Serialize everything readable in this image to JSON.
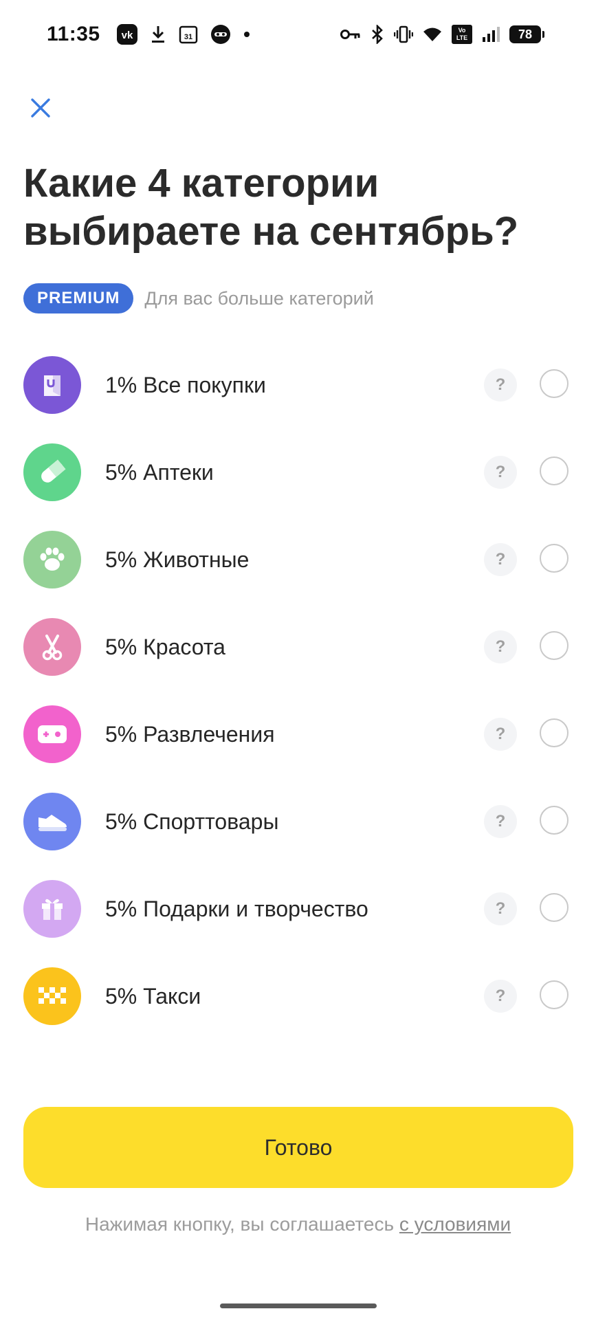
{
  "status_bar": {
    "time": "11:35",
    "left_icons": [
      "vk-icon",
      "download-icon",
      "calendar-icon",
      "incognito-icon",
      "dot-icon"
    ],
    "calendar_day": "31",
    "volte_top": "Vo",
    "volte_bottom": "LTE",
    "battery": "78",
    "right_icons": [
      "key-icon",
      "bluetooth-icon",
      "vibrate-icon",
      "wifi-icon",
      "volte-icon",
      "signal-icon",
      "battery-icon"
    ]
  },
  "header": {
    "close_icon": "close-icon",
    "title_line1": "Какие 4 категории",
    "title_line2": "выбираете на сентябрь?"
  },
  "premium": {
    "badge": "PREMIUM",
    "text": "Для вас больше категорий",
    "badge_color": "#3f6fd8"
  },
  "categories": [
    {
      "label": "1% Все покупки",
      "icon": "shopping-bag-icon",
      "color": "#7b57d6",
      "selected": false
    },
    {
      "label": "5% Аптеки",
      "icon": "pill-icon",
      "color": "#5fd58c",
      "selected": false
    },
    {
      "label": "5% Животные",
      "icon": "paw-icon",
      "color": "#94d296",
      "selected": false
    },
    {
      "label": "5% Красота",
      "icon": "scissors-icon",
      "color": "#e889b2",
      "selected": false
    },
    {
      "label": "5% Развлечения",
      "icon": "gamepad-icon",
      "color": "#f262cc",
      "selected": false
    },
    {
      "label": "5% Спорттовары",
      "icon": "sneaker-icon",
      "color": "#6f86f0",
      "selected": false
    },
    {
      "label": "5% Подарки и творчество",
      "icon": "gift-icon",
      "color": "#d3a8f2",
      "selected": false
    },
    {
      "label": "5% Такси",
      "icon": "taxi-checker-icon",
      "color": "#fbc31c",
      "selected": false
    }
  ],
  "help_label": "?",
  "done_button": {
    "label": "Готово",
    "color": "#fddd2b"
  },
  "terms": {
    "text": "Нажимая кнопку, вы соглашаетесь ",
    "link": "с условиями"
  }
}
